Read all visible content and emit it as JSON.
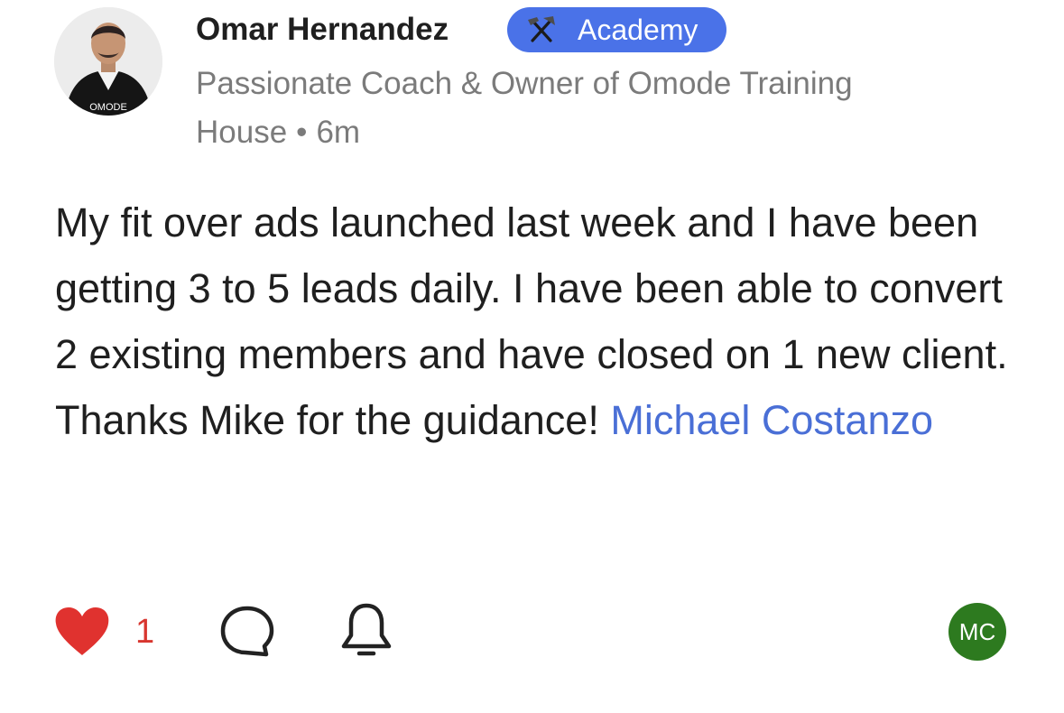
{
  "author": {
    "name": "Omar Hernandez",
    "badge": {
      "label": "Academy",
      "icon": "hammer-pick-icon",
      "color": "#4a72e8"
    },
    "bio": "Passionate Coach & Owner of Omode Training House",
    "separator": "•",
    "time": "6m",
    "avatar": {
      "icon": "profile-photo",
      "caption": "OMODE"
    }
  },
  "post": {
    "text": "My fit over ads launched last week and I have been getting 3 to 5 leads daily. I have been able to convert 2 existing members and have closed on 1 new client. Thanks Mike for the guidance!",
    "mention": "Michael Costanzo",
    "mention_color": "#4a6fd6"
  },
  "actions": {
    "like": {
      "icon": "heart-icon",
      "count": "1",
      "color": "#d8362f"
    },
    "comment": {
      "icon": "comment-bubble-icon"
    },
    "follow": {
      "icon": "bell-icon"
    },
    "reactor": {
      "initials": "MC",
      "color": "#2d7a1f"
    }
  }
}
